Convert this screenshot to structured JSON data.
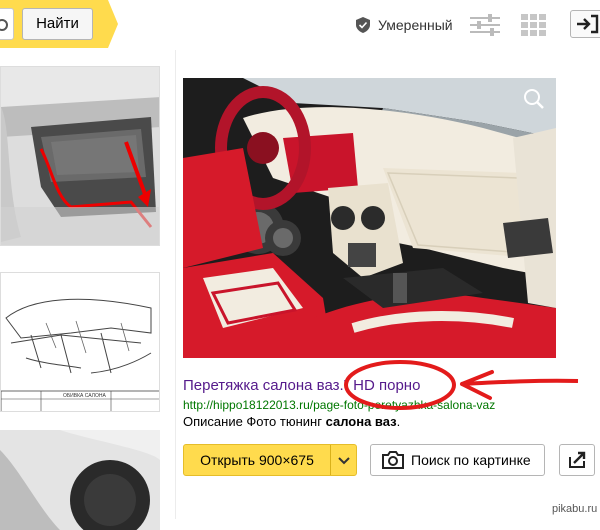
{
  "header": {
    "find_label": "Найти",
    "safe_search_label": "Умеренный"
  },
  "result": {
    "title": "Перетяжка салона ваз.\" HD порно",
    "url": "http://hippo18122013.ru/page-foto-peretyazhka-salona-vaz",
    "description_prefix": "Описание Фото тюнинг ",
    "description_bold": "салона ваз",
    "description_suffix": "."
  },
  "actions": {
    "open_label": "Открыть 900×675",
    "search_by_image_label": "Поиск по картинке"
  },
  "thumbnails": {
    "drawing_caption": "ОБИВКА САЛОНА"
  },
  "watermark": "pikabu.ru",
  "colors": {
    "accent_yellow": "#ffdb4d",
    "link": "#551a8b",
    "url_green": "#007700",
    "annotation_red": "#e31b1b"
  },
  "icons": [
    "camera-icon",
    "shield-icon",
    "sliders-icon",
    "grid-icon",
    "exit-icon",
    "zoom-icon",
    "chevron-down-icon",
    "share-icon"
  ]
}
